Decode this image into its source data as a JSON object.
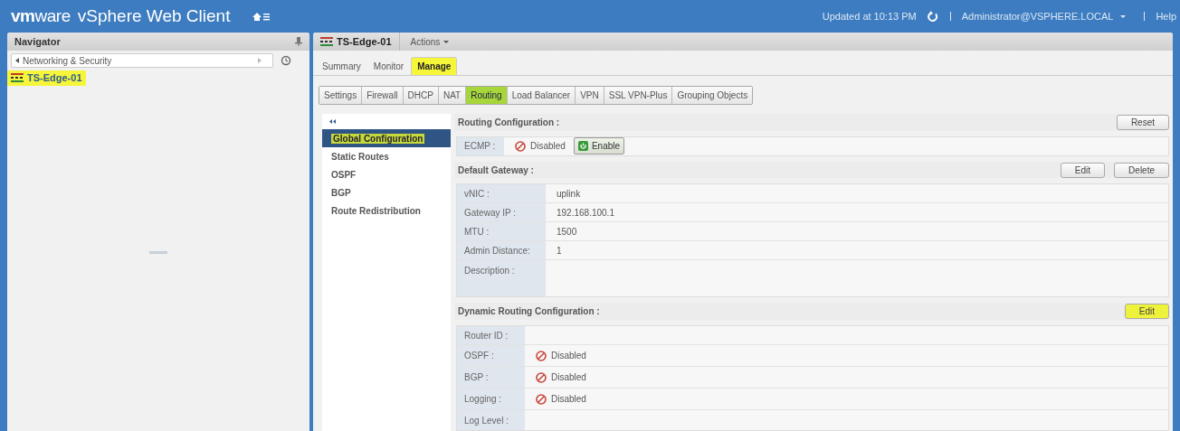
{
  "header": {
    "logo": "**vm**ware",
    "product": "vSphere Web Client",
    "updated": "Updated at 10:13 PM",
    "user": "Administrator@VSPHERE.LOCAL",
    "help": "Help"
  },
  "navigator": {
    "title": "Navigator",
    "breadcrumb": "Networking & Security",
    "items": [
      {
        "label": "TS-Edge-01",
        "highlighted": true
      }
    ]
  },
  "object": {
    "title": "TS-Edge-01",
    "actions": "Actions"
  },
  "tabs": [
    {
      "label": "Summary",
      "selected": false,
      "highlighted": false
    },
    {
      "label": "Monitor",
      "selected": false,
      "highlighted": false
    },
    {
      "label": "Manage",
      "selected": true,
      "highlighted": true
    }
  ],
  "subtabs": [
    {
      "label": "Settings",
      "selected": false
    },
    {
      "label": "Firewall",
      "selected": false
    },
    {
      "label": "DHCP",
      "selected": false
    },
    {
      "label": "NAT",
      "selected": false
    },
    {
      "label": "Routing",
      "selected": true
    },
    {
      "label": "Load Balancer",
      "selected": false
    },
    {
      "label": "VPN",
      "selected": false
    },
    {
      "label": "SSL VPN-Plus",
      "selected": false
    },
    {
      "label": "Grouping Objects",
      "selected": false
    }
  ],
  "side_nav": [
    {
      "label": "Global Configuration",
      "selected": true,
      "highlighted": true
    },
    {
      "label": "Static Routes",
      "selected": false,
      "highlighted": false
    },
    {
      "label": "OSPF",
      "selected": false,
      "highlighted": false
    },
    {
      "label": "BGP",
      "selected": false,
      "highlighted": false
    },
    {
      "label": "Route Redistribution",
      "selected": false,
      "highlighted": false
    }
  ],
  "sections": [
    {
      "title": "Routing Configuration :",
      "buttons": [
        {
          "label": "Reset",
          "highlighted": false
        }
      ],
      "rows": [
        {
          "kind": "status_action",
          "label": "ECMP :",
          "value": "Disabled",
          "action": "Enable"
        }
      ]
    },
    {
      "title": "Default Gateway :",
      "buttons": [
        {
          "label": "Edit",
          "highlighted": false
        },
        {
          "label": "Delete",
          "highlighted": false
        }
      ],
      "rows": [
        {
          "kind": "text",
          "label": "vNIC :",
          "value": "uplink"
        },
        {
          "kind": "text",
          "label": "Gateway IP :",
          "value": "192.168.100.1"
        },
        {
          "kind": "text",
          "label": "MTU :",
          "value": "1500"
        },
        {
          "kind": "text",
          "label": "Admin Distance:",
          "value": "1"
        },
        {
          "kind": "tall",
          "label": "Description :"
        }
      ]
    },
    {
      "title": "Dynamic Routing Configuration :",
      "buttons": [
        {
          "label": "Edit",
          "highlighted": true
        }
      ],
      "rows": [
        {
          "kind": "text",
          "label": "Router ID :"
        },
        {
          "kind": "status",
          "label": "OSPF :",
          "value": "Disabled"
        },
        {
          "kind": "status",
          "label": "BGP :",
          "value": "Disabled"
        },
        {
          "kind": "status",
          "label": "Logging :",
          "value": "Disabled"
        },
        {
          "kind": "cut",
          "label": "Log Level :"
        }
      ]
    }
  ]
}
